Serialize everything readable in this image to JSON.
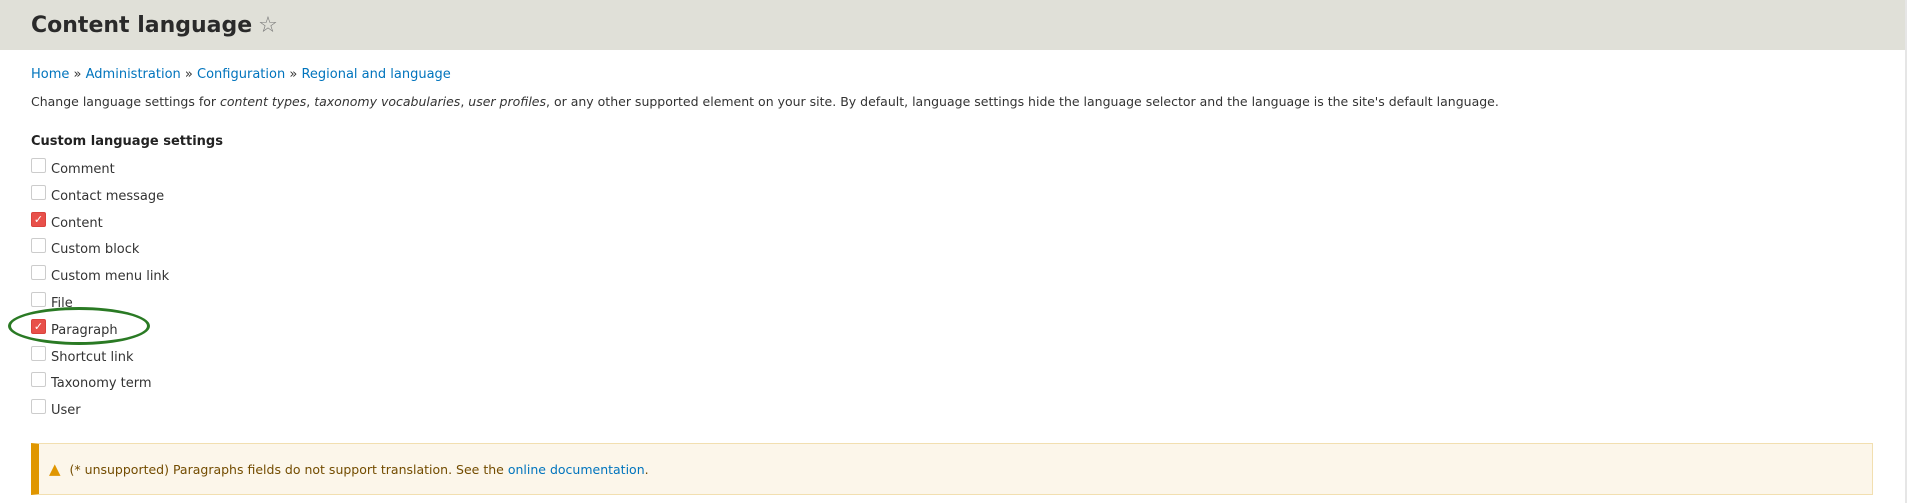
{
  "header": {
    "title": "Content language",
    "star_icon": "star-outline-icon"
  },
  "breadcrumb": [
    "Home",
    "Administration",
    "Configuration",
    "Regional and language"
  ],
  "breadcrumb_sep": "»",
  "description": {
    "prefix": "Change language settings for ",
    "em1": "content types",
    "sep1": ", ",
    "em2": "taxonomy vocabularies",
    "sep2": ", ",
    "em3": "user profiles",
    "suffix": ", or any other supported element on your site. By default, language settings hide the language selector and the language is the site's default language."
  },
  "custom_settings": {
    "legend": "Custom language settings",
    "items": [
      {
        "label": "Comment",
        "checked": false
      },
      {
        "label": "Contact message",
        "checked": false
      },
      {
        "label": "Content",
        "checked": true
      },
      {
        "label": "Custom block",
        "checked": false
      },
      {
        "label": "Custom menu link",
        "checked": false
      },
      {
        "label": "File",
        "checked": false
      },
      {
        "label": "Paragraph",
        "checked": true
      },
      {
        "label": "Shortcut link",
        "checked": false
      },
      {
        "label": "Taxonomy term",
        "checked": false
      },
      {
        "label": "User",
        "checked": false
      }
    ]
  },
  "warning": {
    "text": "(* unsupported) Paragraphs fields do not support translation. See the ",
    "link": "online documentation",
    "end": "."
  },
  "colors": {
    "accent": "#0074bd",
    "checked": "#e8504a",
    "warning": "#e09600",
    "annotation": "#2a7a24"
  }
}
